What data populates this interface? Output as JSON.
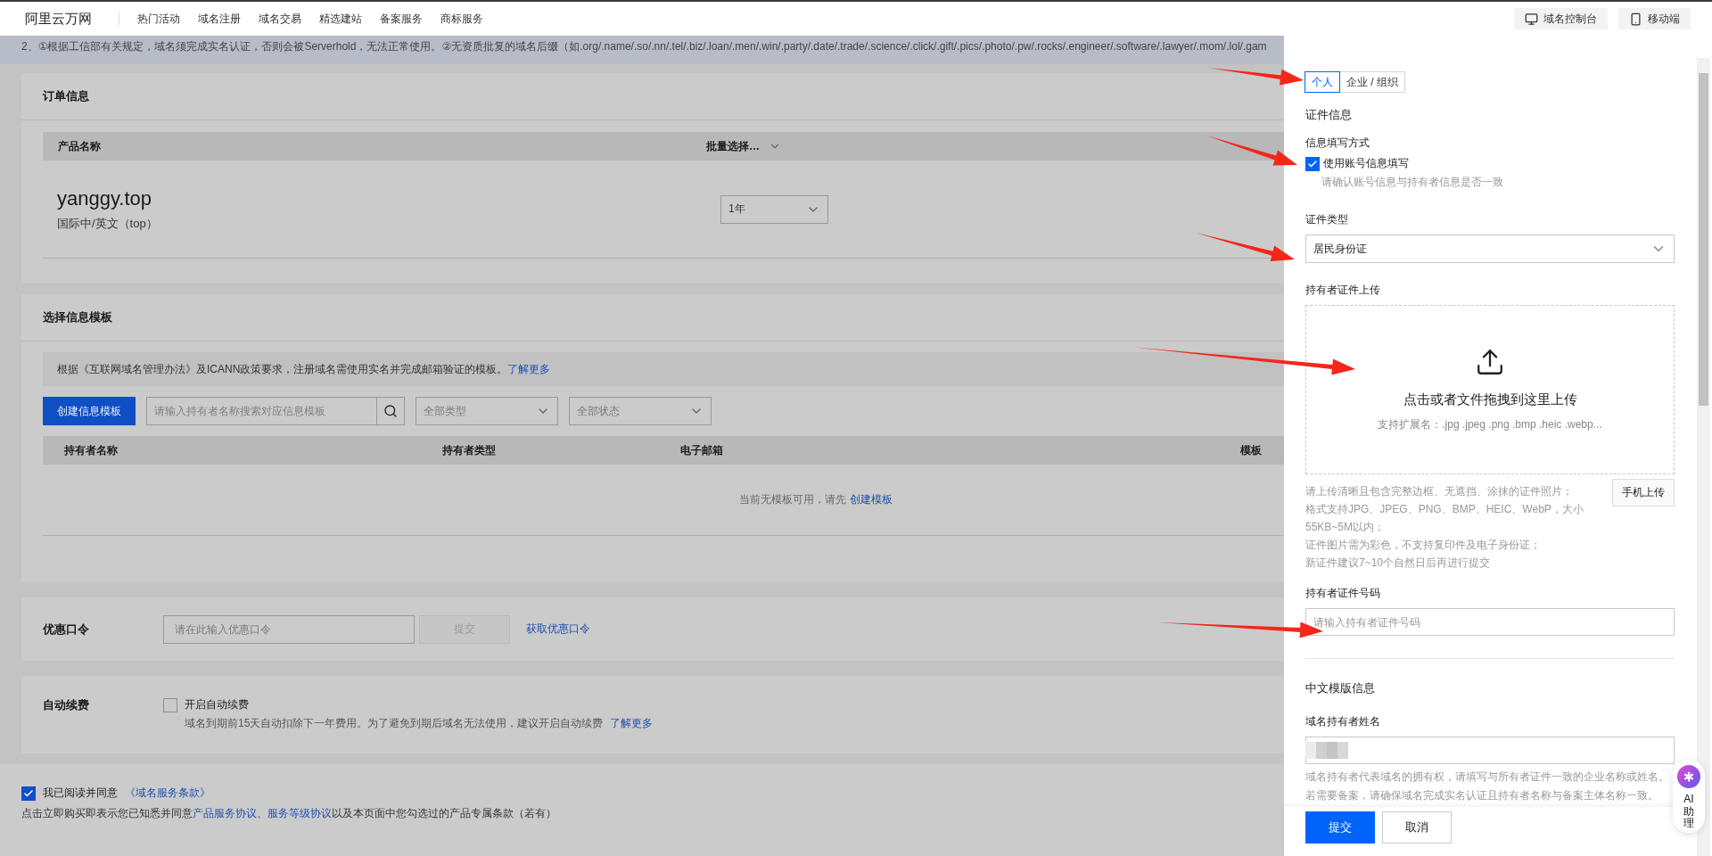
{
  "top_nav": {
    "logo": "阿里云万网",
    "items": [
      "热门活动",
      "域名注册",
      "域名交易",
      "精选建站",
      "备案服务",
      "商标服务"
    ],
    "buttons": [
      {
        "label": "域名控制台",
        "kind": "console"
      },
      {
        "label": "移动端",
        "kind": "mobile"
      }
    ]
  },
  "notice": "2、①根据工信部有关规定，域名须完成实名认证，否则会被Serverhold，无法正常使用。②无资质批复的域名后缀（如.org/.name/.so/.nn/.tel/.biz/.loan/.men/.win/.party/.date/.trade/.science/.click/.gift/.pics/.photo/.pw/.rocks/.engineer/.software/.lawyer/.mom/.lol/.gam",
  "order_info": {
    "title": "订单信息",
    "columns": [
      "产品名称",
      "批量选择…"
    ],
    "rows": [
      {
        "domain": "yanggy.top",
        "type": "国际中/英文（top）",
        "period": "1年"
      }
    ]
  },
  "template_section": {
    "title": "选择信息模板",
    "info": "根据《互联网域名管理办法》及ICANN政策要求，注册域名需使用实名并完成邮箱验证的模板。",
    "info_link": "了解更多",
    "create_button": "创建信息模板",
    "search": {
      "placeholder": "请输入持有者名称搜索对应信息模板"
    },
    "filters": [
      "全部类型",
      "全部状态"
    ],
    "columns": [
      "持有者名称",
      "持有者类型",
      "电子邮箱",
      "模板"
    ],
    "empty_text": "当前无模板可用，请先",
    "empty_link": "创建模板"
  },
  "coupon": {
    "label": "优惠口令",
    "placeholder": "请在此输入优惠口令",
    "button": "提交",
    "disabled": true,
    "link": "获取优惠口令"
  },
  "auto_renew": {
    "label": "自动续费",
    "option": "开启自动续费",
    "checked": false,
    "description": "域名到期前15天自动扣除下一年费用。为了避免到期后域名无法使用，建议开启自动续费",
    "link": "了解更多"
  },
  "agreement": {
    "checked": true,
    "text": "我已阅读并同意",
    "link": "《域名服务条款》",
    "note": [
      {
        "text": "点击立即购买即表示您已知悉并同意",
        "link": false
      },
      {
        "text": "产品服务协议",
        "link": true
      },
      {
        "text": "、",
        "link": false
      },
      {
        "text": "服务等级协议",
        "link": true
      },
      {
        "text": "以及本页面中您勾选过的产品专属条款（若有）",
        "link": false
      }
    ]
  },
  "drawer": {
    "tabs": [
      {
        "label": "个人",
        "selected": true
      },
      {
        "label": "企业 / 组织",
        "selected": false
      }
    ],
    "cert_title": "证件信息",
    "fill_method": {
      "label": "信息填写方式",
      "option": "使用账号信息填写",
      "checked": true,
      "hint": "请确认账号信息与持有者信息是否一致"
    },
    "cert_type": {
      "label": "证件类型",
      "value": "居民身份证"
    },
    "upload": {
      "label": "持有者证件上传",
      "title": "点击或者文件拖拽到这里上传",
      "extensions": "支持扩展名：.jpg .jpeg .png .bmp .heic .webp...",
      "notes": [
        "请上传清晰且包含完整边框、无遮挡、涂抹的证件照片；",
        "格式支持JPG、JPEG、PNG、BMP、HEIC、WebP，大小55KB~5M以内；",
        "证件图片需为彩色，不支持复印件及电子身份证；",
        "新证件建议7~10个自然日后再进行提交"
      ],
      "mobile_button": "手机上传"
    },
    "cert_number": {
      "label": "持有者证件号码",
      "placeholder": "请输入持有者证件号码"
    },
    "cn_title": "中文模版信息",
    "holder_name": {
      "label": "域名持有者姓名",
      "redacted": true,
      "hints": [
        "域名持有者代表域名的拥有权，请填写与所有者证件一致的企业名称或姓名。",
        "若需要备案，请确保域名完成实名认证且持有者名称与备案主体名称一致。"
      ]
    },
    "footer_buttons": [
      {
        "label": "提交",
        "kind": "primary"
      },
      {
        "label": "取消",
        "kind": "default"
      }
    ],
    "assistant": {
      "label": "AI助理"
    }
  },
  "annotations": [
    {
      "kind": "arrow"
    },
    {
      "kind": "arrow"
    },
    {
      "kind": "arrow"
    },
    {
      "kind": "arrow"
    },
    {
      "kind": "arrow"
    }
  ]
}
